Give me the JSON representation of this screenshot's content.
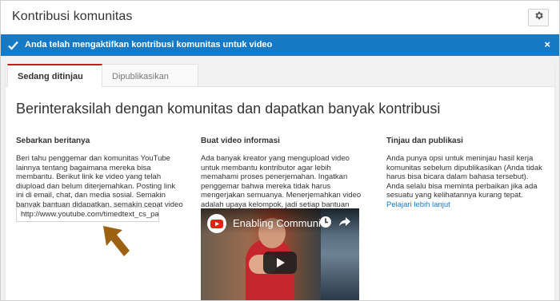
{
  "header": {
    "title": "Kontribusi komunitas",
    "settings_icon": "gear-icon"
  },
  "banner": {
    "text": "Anda telah mengaktifkan kontribusi komunitas untuk video",
    "close_label": "×",
    "color": "#167ac6"
  },
  "tabs": [
    {
      "label": "Sedang ditinjau",
      "active": true
    },
    {
      "label": "Dipublikasikan",
      "active": false
    }
  ],
  "main": {
    "heading": "Berinteraksilah dengan komunitas dan dapatkan banyak kontribusi"
  },
  "columns": [
    {
      "title": "Sebarkan beritanya",
      "text": "Beri tahu penggemar dan komunitas YouTube lainnya tentang bagaimana mereka bisa membantu. Berikut link ke video yang telah diupload dan belum diterjemahkan. Posting link ini di email, chat, dan media sosial. Semakin banyak bantuan didapatkan, semakin cepat video Anda diterjemahkan."
    },
    {
      "title": "Buat video informasi",
      "text": "Ada banyak kreator yang mengupload video untuk membantu kontributor agar lebih memahami proses penerjemahan. Ingatkan penggemar bahwa mereka tidak harus mengerjakan semuanya. Menerjemahkan video adalah upaya kelompok, jadi setiap bantuan sangat bermanfaat."
    },
    {
      "title": "Tinjau dan publikasi",
      "text": "Anda punya opsi untuk meninjau hasil kerja komunitas sebelum dipublikasikan (Anda tidak harus bisa bicara dalam bahasa tersebut). Anda selalu bisa meminta perbaikan jika ada sesuatu yang kelihatannya kurang tepat.",
      "link": "Pelajari lebih lanjut"
    }
  ],
  "share_link": {
    "value": "http://www.youtube.com/timedtext_cs_pan"
  },
  "video": {
    "title": "Enabling Community",
    "icons": [
      "youtube-logo-icon",
      "clock-icon",
      "share-icon",
      "play-icon"
    ]
  },
  "colors": {
    "accent_red": "#cc181e",
    "link_blue": "#167ac6",
    "arrow_brown": "#9c6211"
  }
}
